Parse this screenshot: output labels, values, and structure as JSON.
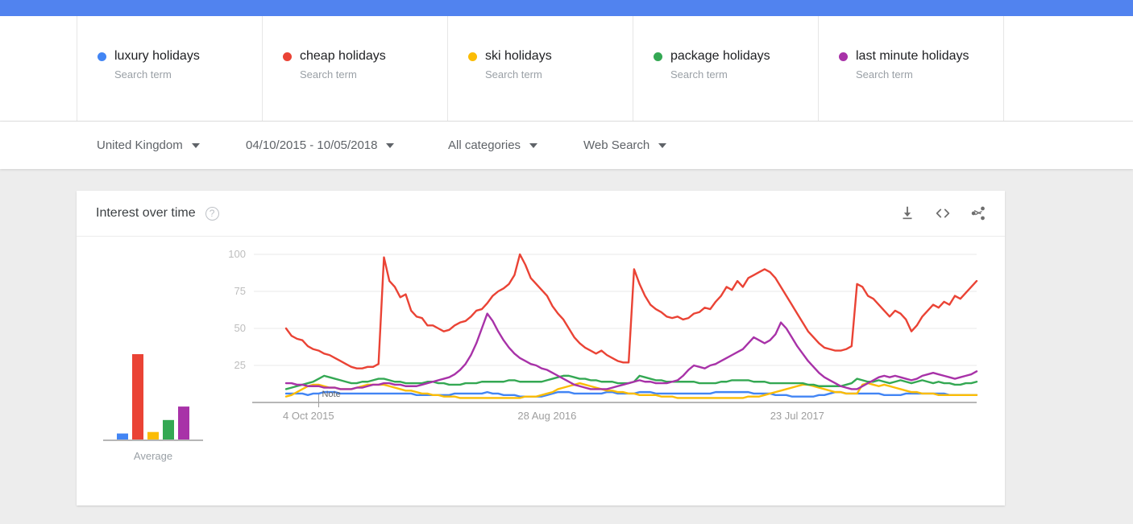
{
  "topbar": {
    "color": "#5183ef"
  },
  "legend": {
    "items": [
      {
        "term": "luxury holidays",
        "subtitle": "Search term",
        "color": "#4285f4"
      },
      {
        "term": "cheap holidays",
        "subtitle": "Search term",
        "color": "#ea4335"
      },
      {
        "term": "ski holidays",
        "subtitle": "Search term",
        "color": "#fbbc05"
      },
      {
        "term": "package holidays",
        "subtitle": "Search term",
        "color": "#34a853"
      },
      {
        "term": "last minute holidays",
        "subtitle": "Search term",
        "color": "#a832a8"
      }
    ]
  },
  "filters": {
    "region": "United Kingdom",
    "date_range": "04/10/2015 - 10/05/2018",
    "category": "All categories",
    "search_type": "Web Search"
  },
  "card": {
    "title": "Interest over time",
    "help_glyph": "?",
    "actions": [
      {
        "name": "download-icon",
        "label": "Download"
      },
      {
        "name": "embed-code-icon",
        "label": "Embed"
      },
      {
        "name": "share-icon",
        "label": "Share"
      }
    ]
  },
  "chart_data": {
    "type": "line",
    "title": "Interest over time",
    "xlabel": "",
    "ylabel": "",
    "ylim": [
      0,
      100
    ],
    "yticks": [
      25,
      50,
      75,
      100
    ],
    "grid": true,
    "legend_position": "top",
    "average_label": "Average",
    "annotation": {
      "text": "Note",
      "x_index": 6
    },
    "xticks": [
      {
        "label": "4 Oct 2015",
        "index": 0
      },
      {
        "label": "28 Aug 2016",
        "index": 48
      },
      {
        "label": "23 Jul 2017",
        "index": 94
      }
    ],
    "averages": [
      {
        "name": "luxury holidays",
        "value": 4
      },
      {
        "name": "cheap holidays",
        "value": 57
      },
      {
        "name": "ski holidays",
        "value": 5
      },
      {
        "name": "package holidays",
        "value": 13
      },
      {
        "name": "last minute holidays",
        "value": 22
      }
    ],
    "series": [
      {
        "name": "luxury holidays",
        "color": "#4285f4",
        "values": [
          6,
          6,
          6,
          6,
          5,
          6,
          6,
          7,
          7,
          7,
          6,
          6,
          6,
          6,
          6,
          6,
          6,
          6,
          6,
          6,
          6,
          6,
          6,
          6,
          5,
          5,
          5,
          5,
          5,
          5,
          5,
          6,
          6,
          6,
          6,
          6,
          6,
          7,
          6,
          6,
          5,
          5,
          5,
          4,
          4,
          4,
          4,
          4,
          5,
          6,
          7,
          7,
          7,
          6,
          6,
          6,
          6,
          6,
          6,
          7,
          7,
          6,
          6,
          6,
          6,
          7,
          7,
          7,
          6,
          6,
          6,
          6,
          6,
          6,
          6,
          6,
          6,
          6,
          6,
          7,
          7,
          7,
          7,
          7,
          7,
          7,
          6,
          6,
          6,
          6,
          5,
          5,
          5,
          4,
          4,
          4,
          4,
          4,
          5,
          5,
          6,
          7,
          7,
          6,
          6,
          6,
          6,
          6,
          6,
          6,
          5,
          5,
          5,
          5,
          6,
          6,
          6,
          6,
          6,
          6,
          6,
          6,
          5,
          5,
          5,
          5,
          5,
          5
        ]
      },
      {
        "name": "cheap holidays",
        "color": "#ea4335",
        "values": [
          50,
          45,
          43,
          42,
          38,
          36,
          35,
          33,
          32,
          30,
          28,
          26,
          24,
          23,
          23,
          24,
          24,
          26,
          98,
          82,
          78,
          71,
          73,
          62,
          58,
          57,
          52,
          52,
          50,
          48,
          49,
          52,
          54,
          55,
          58,
          62,
          63,
          67,
          72,
          75,
          77,
          80,
          86,
          100,
          93,
          84,
          80,
          76,
          72,
          65,
          60,
          56,
          50,
          44,
          40,
          37,
          35,
          33,
          35,
          32,
          30,
          28,
          27,
          27,
          90,
          80,
          72,
          66,
          63,
          61,
          58,
          57,
          58,
          56,
          57,
          60,
          61,
          64,
          63,
          68,
          72,
          78,
          76,
          82,
          78,
          84,
          86,
          88,
          90,
          88,
          84,
          78,
          72,
          66,
          60,
          54,
          48,
          44,
          40,
          37,
          36,
          35,
          35,
          36,
          38,
          80,
          78,
          72,
          70,
          66,
          62,
          58,
          62,
          60,
          56,
          48,
          52,
          58,
          62,
          66,
          64,
          68,
          66,
          72,
          70,
          74,
          78,
          82
        ]
      },
      {
        "name": "ski holidays",
        "color": "#fbbc05",
        "values": [
          4,
          5,
          7,
          9,
          11,
          12,
          12,
          11,
          10,
          10,
          9,
          9,
          9,
          10,
          11,
          12,
          12,
          12,
          12,
          11,
          10,
          9,
          8,
          8,
          7,
          6,
          6,
          5,
          5,
          4,
          4,
          4,
          3,
          3,
          3,
          3,
          3,
          3,
          3,
          3,
          3,
          3,
          3,
          3,
          4,
          4,
          4,
          5,
          6,
          7,
          9,
          10,
          11,
          12,
          13,
          12,
          11,
          10,
          9,
          8,
          8,
          7,
          7,
          6,
          6,
          5,
          5,
          5,
          5,
          4,
          4,
          4,
          3,
          3,
          3,
          3,
          3,
          3,
          3,
          3,
          3,
          3,
          3,
          3,
          3,
          4,
          4,
          4,
          5,
          6,
          7,
          8,
          9,
          10,
          11,
          12,
          12,
          11,
          10,
          9,
          8,
          7,
          7,
          6,
          6,
          6,
          12,
          13,
          12,
          11,
          12,
          11,
          10,
          9,
          8,
          7,
          7,
          6,
          6,
          6,
          5,
          5,
          5,
          5,
          5,
          5,
          5,
          5
        ]
      },
      {
        "name": "package holidays",
        "color": "#34a853",
        "values": [
          9,
          10,
          11,
          12,
          13,
          14,
          16,
          18,
          17,
          16,
          15,
          14,
          13,
          13,
          14,
          14,
          15,
          16,
          16,
          15,
          14,
          14,
          13,
          13,
          13,
          13,
          14,
          14,
          13,
          13,
          12,
          12,
          12,
          13,
          13,
          13,
          14,
          14,
          14,
          14,
          14,
          15,
          15,
          14,
          14,
          14,
          14,
          14,
          15,
          16,
          17,
          18,
          18,
          17,
          16,
          16,
          15,
          15,
          14,
          14,
          14,
          13,
          13,
          13,
          14,
          18,
          17,
          16,
          15,
          15,
          14,
          14,
          14,
          14,
          14,
          14,
          13,
          13,
          13,
          13,
          14,
          14,
          15,
          15,
          15,
          15,
          14,
          14,
          14,
          13,
          13,
          13,
          13,
          13,
          13,
          13,
          12,
          12,
          11,
          11,
          11,
          11,
          11,
          12,
          13,
          16,
          15,
          14,
          14,
          15,
          14,
          13,
          14,
          15,
          14,
          13,
          14,
          15,
          14,
          13,
          14,
          13,
          13,
          12,
          12,
          13,
          13,
          14
        ]
      },
      {
        "name": "last minute holidays",
        "color": "#a832a8",
        "values": [
          13,
          13,
          12,
          12,
          11,
          11,
          11,
          10,
          10,
          10,
          9,
          9,
          9,
          10,
          10,
          11,
          12,
          12,
          13,
          13,
          12,
          12,
          11,
          11,
          11,
          12,
          13,
          14,
          15,
          16,
          17,
          19,
          22,
          26,
          32,
          40,
          50,
          60,
          55,
          48,
          42,
          37,
          33,
          30,
          28,
          26,
          25,
          23,
          22,
          20,
          18,
          16,
          14,
          12,
          11,
          10,
          9,
          9,
          9,
          9,
          10,
          11,
          12,
          13,
          14,
          15,
          14,
          14,
          13,
          13,
          13,
          14,
          15,
          18,
          22,
          25,
          24,
          23,
          25,
          26,
          28,
          30,
          32,
          34,
          36,
          40,
          44,
          42,
          40,
          42,
          46,
          54,
          50,
          44,
          38,
          33,
          28,
          24,
          20,
          17,
          15,
          13,
          11,
          10,
          9,
          9,
          11,
          13,
          15,
          17,
          18,
          17,
          18,
          17,
          16,
          15,
          16,
          18,
          19,
          20,
          19,
          18,
          17,
          16,
          17,
          18,
          19,
          21
        ]
      }
    ]
  }
}
